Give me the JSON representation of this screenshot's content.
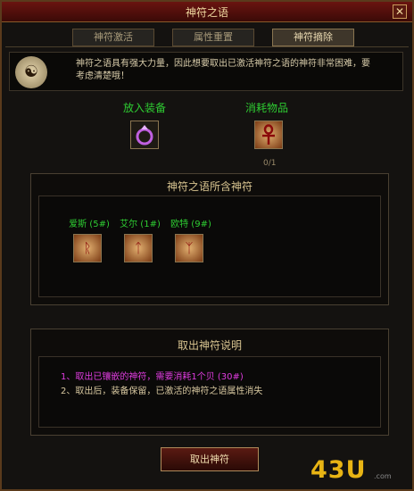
{
  "window": {
    "title": "神符之语",
    "close_glyph": "✕"
  },
  "tabs": [
    {
      "label": "神符激活",
      "active": false
    },
    {
      "label": "属性重置",
      "active": false
    },
    {
      "label": "神符摘除",
      "active": true
    }
  ],
  "notice": {
    "icon": "rune-scroll-icon",
    "line1": "神符之语具有强大力量，因此想要取出已激活神符之语的神符非常困难，要",
    "line2": "考虑清楚哦！"
  },
  "equip_slot": {
    "label": "放入装备",
    "item_icon": "ring-icon"
  },
  "consume_slot": {
    "label": "消耗物品",
    "item_icon": "ankh-rune-icon",
    "count": "0/1"
  },
  "runes_panel": {
    "title": "神符之语所含神符",
    "runes": [
      {
        "name": "爱斯 (5#)",
        "icon": "rune-ais-icon",
        "glyph": "ᚱ"
      },
      {
        "name": "艾尔 (1#)",
        "icon": "rune-el-icon",
        "glyph": "ᛏ"
      },
      {
        "name": "欧特 (9#)",
        "icon": "rune-ort-icon",
        "glyph": "ᛉ"
      }
    ]
  },
  "info_panel": {
    "title": "取出神符说明",
    "line1": "1、取出已镶嵌的神符，需要消耗1个贝 (30#)",
    "line2": "2、取出后，装备保留，已激活的神符之语属性消失"
  },
  "action_button": {
    "label": "取出神符"
  },
  "watermark": {
    "logo": "43U",
    "sub": ".com"
  },
  "colors": {
    "green_label": "#2ecc32",
    "magenta_text": "#e03ce0",
    "title_bar": "#6a1410"
  }
}
